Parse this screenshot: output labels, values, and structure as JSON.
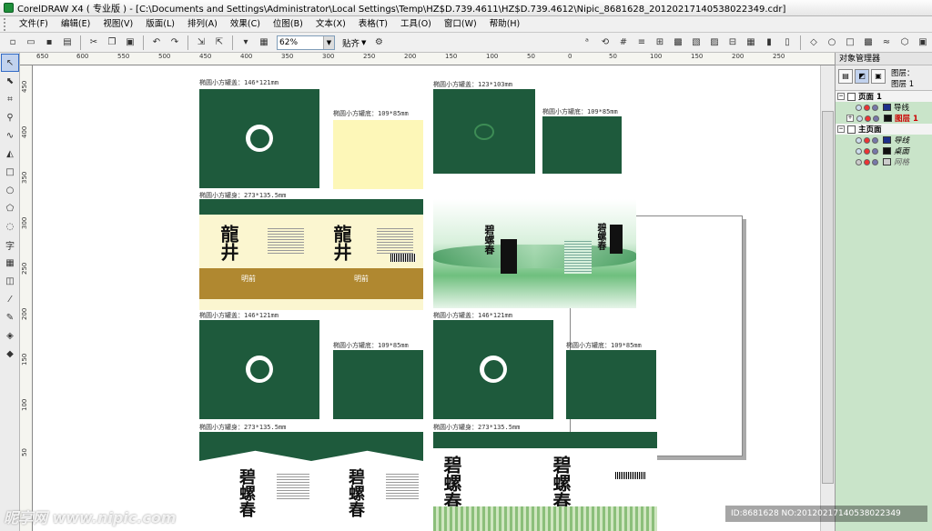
{
  "window": {
    "title": "CorelDRAW X4 ( 专业版 ) - [C:\\Documents and Settings\\Administrator\\Local Settings\\Temp\\HZ$D.739.4611\\HZ$D.739.4612\\Nipic_8681628_20120217140538022349.cdr]"
  },
  "menu": [
    "文件(F)",
    "编辑(E)",
    "视图(V)",
    "版面(L)",
    "排列(A)",
    "效果(C)",
    "位图(B)",
    "文本(X)",
    "表格(T)",
    "工具(O)",
    "窗口(W)",
    "帮助(H)"
  ],
  "toolbar": {
    "zoom": "62%",
    "snap_label": "贴齐",
    "icons": [
      "new-icon",
      "open-icon",
      "save-icon",
      "print-icon",
      "cut-icon",
      "copy-icon",
      "paste-icon",
      "undo-icon",
      "redo-icon",
      "import-icon",
      "export-icon",
      "app-launcher-icon",
      "welcome-icon"
    ]
  },
  "ruler": {
    "h_ticks": [
      "650",
      "600",
      "550",
      "500",
      "450",
      "400",
      "350",
      "300",
      "250",
      "200",
      "150",
      "100",
      "50",
      "0",
      "50",
      "100",
      "150",
      "200",
      "250"
    ],
    "v_ticks": [
      "450",
      "400",
      "350",
      "300",
      "250",
      "200",
      "150",
      "100",
      "50"
    ]
  },
  "docker": {
    "title": "对象管理器",
    "layer_info": [
      "图层：",
      "图层 1"
    ],
    "rows": [
      {
        "type": "page",
        "label": "页面 1"
      },
      {
        "type": "layer",
        "label": "导线"
      },
      {
        "type": "layer",
        "label": "图层 1",
        "active": true
      },
      {
        "type": "page",
        "label": "主页面"
      },
      {
        "type": "layer",
        "label": "导线"
      },
      {
        "type": "layer",
        "label": "桌面"
      },
      {
        "type": "layer",
        "label": "网格"
      }
    ]
  },
  "canvas": {
    "labels": {
      "lid1": "椭圆小方罐盖：146*121mm",
      "base1": "椭圆小方罐底：109*85mm",
      "lid2": "椭圆小方罐盖：123*103mm",
      "base2": "椭圆小方罐底：109*85mm",
      "body1": "椭圆小方罐身：273*135.5mm",
      "body2": "椭圆小方罐身：273*135.5mm",
      "lid3": "椭圆小方罐盖：146*121mm",
      "base3": "椭圆小方罐底：109*85mm",
      "lid4": "椭圆小方罐盖：146*121mm",
      "base4": "椭圆小方罐底：109*85mm",
      "body3": "椭圆小方罐身：273*135.5mm",
      "body4": "椭圆小方罐身：273*135.5mm"
    },
    "product_text": {
      "longjing": "龍井",
      "longjing_sub": "明前",
      "biluochun": "碧螺春",
      "biluochun2": "碧螺春",
      "tea_label": "碧螺春"
    }
  },
  "watermark": {
    "left": "昵享网 www.nipic.com",
    "right": "ID:8681628 NO:20120217140538022349"
  }
}
